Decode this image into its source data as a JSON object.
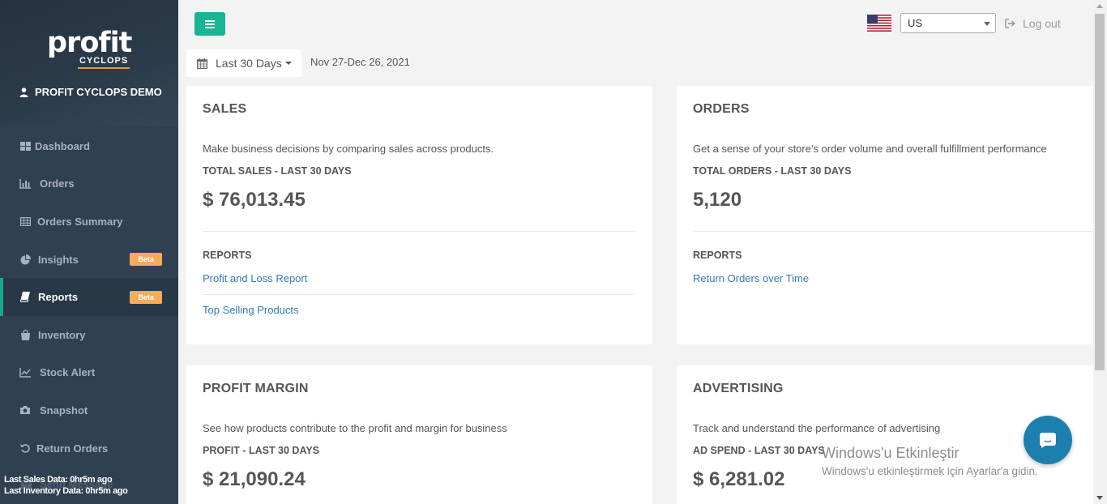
{
  "brand": {
    "logo_main": "profit",
    "logo_sub": "CYCLOPS"
  },
  "user": {
    "name": "PROFIT CYCLOPS DEMO"
  },
  "sidebar": {
    "items": [
      {
        "label": "Dashboard",
        "icon": "dashboard-icon"
      },
      {
        "label": "Orders",
        "icon": "bar-chart-icon"
      },
      {
        "label": "Orders Summary",
        "icon": "table-icon"
      },
      {
        "label": "Insights",
        "icon": "pie-chart-icon",
        "badge": "Beta"
      },
      {
        "label": "Reports",
        "icon": "book-icon",
        "badge": "Beta",
        "active": true
      },
      {
        "label": "Inventory",
        "icon": "shopping-bag-icon"
      },
      {
        "label": "Stock Alert",
        "icon": "line-chart-icon"
      },
      {
        "label": "Snapshot",
        "icon": "camera-icon"
      },
      {
        "label": "Return Orders",
        "icon": "undo-icon"
      }
    ],
    "ghost_item": "Send Message",
    "last_sales": "Last Sales Data: 0hr5m ago",
    "last_inventory": "Last Inventory Data: 0hr5m ago"
  },
  "topbar": {
    "country": "US",
    "logout_label": "Log out"
  },
  "date_filter": {
    "label": "Last 30 Days",
    "range": "Nov 27-Dec 26, 2021"
  },
  "cards": {
    "sales": {
      "title": "SALES",
      "description": "Make business decisions by comparing sales across products.",
      "metric_label": "TOTAL SALES - LAST 30 DAYS",
      "metric_value": "$ 76,013.45",
      "reports_label": "REPORTS",
      "links": [
        "Profit and Loss Report",
        "Top Selling Products"
      ]
    },
    "orders": {
      "title": "ORDERS",
      "description": "Get a sense of your store's order volume and overall fulfillment performance",
      "metric_label": "TOTAL ORDERS - LAST 30 DAYS",
      "metric_value": "5,120",
      "reports_label": "REPORTS",
      "links": [
        "Return Orders over Time"
      ]
    },
    "profit_margin": {
      "title": "PROFIT MARGIN",
      "description": "See how products contribute to the profit and margin for business",
      "metric_label": "PROFIT - LAST 30 DAYS",
      "metric_value": "$ 21,090.24"
    },
    "advertising": {
      "title": "ADVERTISING",
      "description": "Track and understand the performance of advertising",
      "metric_label": "AD SPEND - LAST 30 DAYS",
      "metric_value": "$ 6,281.02"
    }
  },
  "watermark": {
    "title": "Windows'u Etkinleştir",
    "subtitle": "Windows'u etkinleştirmek için Ayarlar'a gidin."
  },
  "colors": {
    "sidebar_bg": "#2f4050",
    "accent": "#1ab394",
    "badge": "#f8ac59",
    "link": "#337ab7",
    "chat": "#1d7fae"
  }
}
